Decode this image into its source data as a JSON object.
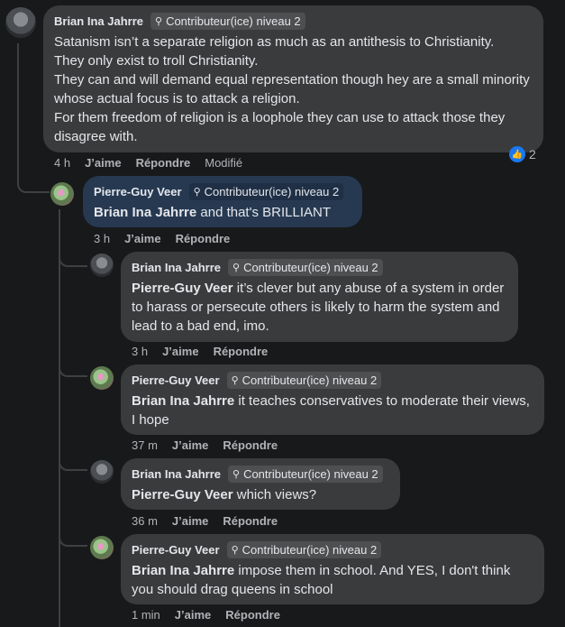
{
  "badge_label": "Contributeur(ice) niveau 2",
  "comments": [
    {
      "author": "Brian Ina Jahrre",
      "mention": "",
      "text": "Satanism isn’t a separate religion as much as an antithesis to Christianity.\nThey only exist to troll Christianity.\nThey can and will demand equal representation though hey are a small minority whose actual focus is to attack a religion.\nFor them freedom of religion is a loophole they can use to attack those they disagree with.",
      "time": "4 h",
      "like": "J’aime",
      "reply": "Répondre",
      "edited": "Modifié",
      "reaction_count": "2"
    },
    {
      "author": "Pierre-Guy Veer",
      "mention": "Brian Ina Jahrre",
      "text": " and that's BRILLIANT",
      "time": "3 h",
      "like": "J’aime",
      "reply": "Répondre"
    },
    {
      "author": "Brian Ina Jahrre",
      "mention": "Pierre-Guy Veer",
      "text": " it’s clever but any abuse of a system in order to harass or persecute others is likely to harm the system and lead to a bad end, imo.",
      "time": "3 h",
      "like": "J’aime",
      "reply": "Répondre"
    },
    {
      "author": "Pierre-Guy Veer",
      "mention": "Brian Ina Jahrre",
      "text": " it teaches conservatives to moderate their views, I hope",
      "time": "37 m",
      "like": "J’aime",
      "reply": "Répondre"
    },
    {
      "author": "Brian Ina Jahrre",
      "mention": "Pierre-Guy Veer",
      "text": " which views?",
      "time": "36 m",
      "like": "J’aime",
      "reply": "Répondre"
    },
    {
      "author": "Pierre-Guy Veer",
      "mention": "Brian Ina Jahrre",
      "text": " impose them in school. And YES, I don't think you should drag queens in school",
      "time": "1 min",
      "like": "J’aime",
      "reply": "Répondre"
    }
  ]
}
